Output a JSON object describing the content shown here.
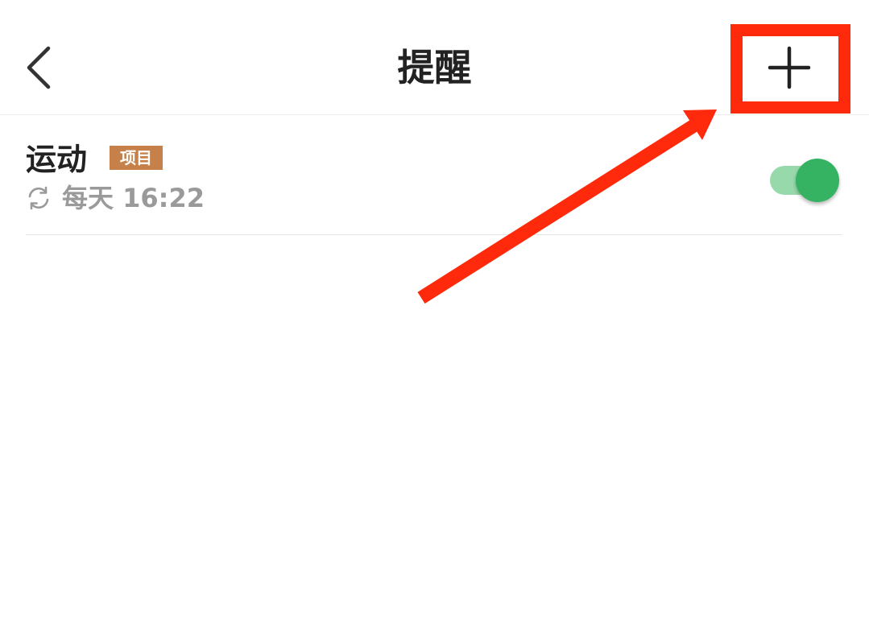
{
  "header": {
    "title": "提醒",
    "back_icon": "chevron-left-icon",
    "add_icon": "plus-icon"
  },
  "reminders": [
    {
      "name": "运动",
      "tag": "项目",
      "repeat_icon": "repeat-icon",
      "schedule": "每天 16:22",
      "enabled": true
    }
  ],
  "colors": {
    "tag_background": "#c6814a",
    "toggle_on": "#35b262",
    "toggle_track_on": "#98d9ac",
    "secondary_text": "#9a9a9a",
    "annotation": "#ff2a0c"
  }
}
